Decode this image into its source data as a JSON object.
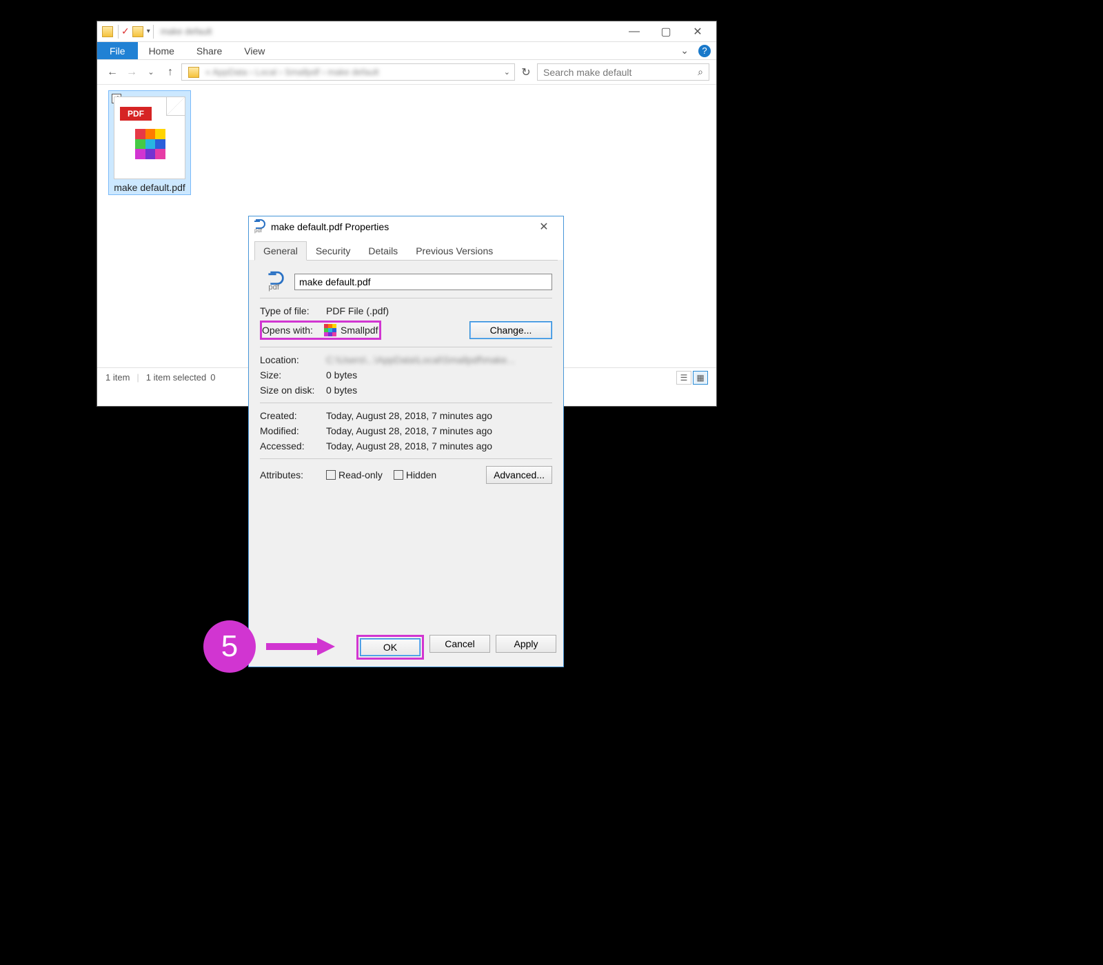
{
  "explorer": {
    "tabs": {
      "file": "File",
      "home": "Home",
      "share": "Share",
      "view": "View"
    },
    "search_placeholder": "Search make default",
    "file": {
      "name": "make default.pdf",
      "badge": "PDF"
    },
    "status": {
      "count": "1 item",
      "selected": "1 item selected",
      "size": "0"
    }
  },
  "dialog": {
    "title": "make default.pdf Properties",
    "tabs": {
      "general": "General",
      "security": "Security",
      "details": "Details",
      "previous": "Previous Versions"
    },
    "filename_value": "make default.pdf",
    "labels": {
      "type": "Type of file:",
      "opens": "Opens with:",
      "location": "Location:",
      "size": "Size:",
      "disk": "Size on disk:",
      "created": "Created:",
      "modified": "Modified:",
      "accessed": "Accessed:",
      "attributes": "Attributes:"
    },
    "values": {
      "type": "PDF File (.pdf)",
      "opens_with": "Smallpdf",
      "size": "0 bytes",
      "disk": "0 bytes",
      "created": "Today, ‎August ‎28, ‎2018, 7 minutes ago",
      "modified": "Today, ‎August ‎28, ‎2018, 7 minutes ago",
      "accessed": "Today, ‎August ‎28, ‎2018, 7 minutes ago",
      "readonly": "Read-only",
      "hidden": "Hidden"
    },
    "buttons": {
      "change": "Change...",
      "advanced": "Advanced...",
      "ok": "OK",
      "cancel": "Cancel",
      "apply": "Apply"
    }
  },
  "callout": {
    "step": "5"
  }
}
